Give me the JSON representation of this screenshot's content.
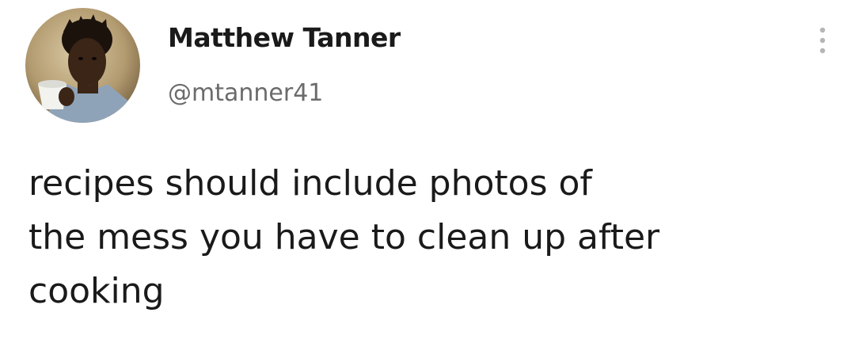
{
  "user": {
    "display_name": "Matthew Tanner",
    "handle": "@mtanner41"
  },
  "icons": {
    "avatar": "profile-photo",
    "more": "vertical-ellipsis-icon"
  },
  "tweet": {
    "lines": [
      "recipes should include photos of",
      "the mess you have to clean up after",
      "cooking"
    ]
  },
  "colors": {
    "text": "#1a1a1a",
    "handle": "#6b6b6b",
    "background": "#ffffff",
    "more_icon": "#b5b5b5"
  }
}
